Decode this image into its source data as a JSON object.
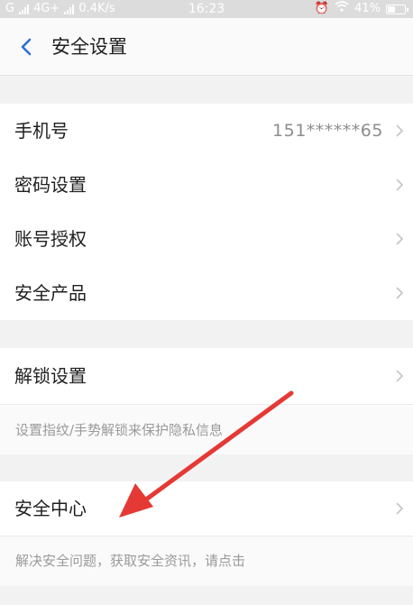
{
  "status_bar": {
    "left_text": "G",
    "network": "4G+",
    "speed": "0.4K/s",
    "time": "16:23",
    "battery": "41%"
  },
  "header": {
    "back_icon": "chevron-left-icon",
    "title": "安全设置"
  },
  "section1": {
    "items": [
      {
        "label": "手机号",
        "value": "151******65"
      },
      {
        "label": "密码设置"
      },
      {
        "label": "账号授权"
      },
      {
        "label": "安全产品"
      }
    ]
  },
  "section2": {
    "label": "解锁设置",
    "description": "设置指纹/手势解锁来保护隐私信息"
  },
  "section3": {
    "label": "安全中心",
    "description": "解决安全问题，获取安全资讯，请点击"
  },
  "colors": {
    "accent": "#2a6fd6",
    "annotation_arrow": "#e53935",
    "background": "#f2f2f2"
  }
}
